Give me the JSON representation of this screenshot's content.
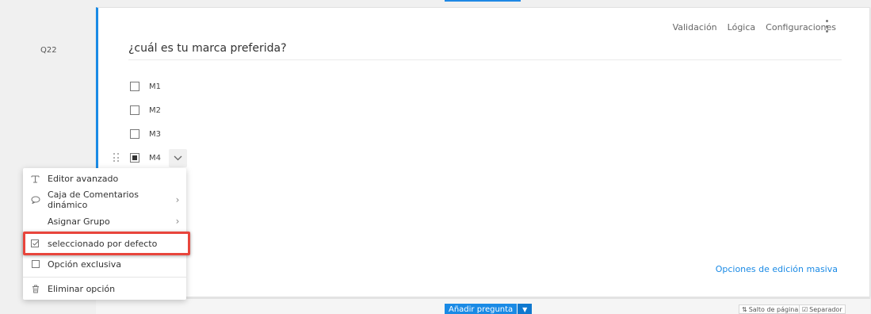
{
  "question": {
    "number": "Q22",
    "title": "¿cuál es tu marca preferida?",
    "actions": [
      "Validación",
      "Lógica",
      "Configuraciones"
    ],
    "options": [
      {
        "label": "M1",
        "checked": false
      },
      {
        "label": "M2",
        "checked": false
      },
      {
        "label": "M3",
        "checked": false
      },
      {
        "label": "M4",
        "checked": true
      }
    ],
    "mass_edit": "Opciones de edición masiva",
    "hidden_fragment": "¿?"
  },
  "context_menu": {
    "items": [
      {
        "icon": "text-format-icon",
        "label": "Editor avanzado",
        "submenu": false
      },
      {
        "icon": "comment-icon",
        "label": "Caja de Comentarios dinámico",
        "submenu": true
      },
      {
        "icon": "",
        "label": "Asignar Grupo",
        "submenu": true
      },
      {
        "icon": "checkbox-checked-icon",
        "label": "seleccionado por defecto",
        "submenu": false,
        "highlighted": true
      },
      {
        "icon": "checkbox-empty-icon",
        "label": "Opción exclusiva",
        "submenu": false
      },
      {
        "icon": "trash-icon",
        "label": "Eliminar opción",
        "submenu": false
      }
    ]
  },
  "bottom_toolbar": {
    "add_question": "Añadir pregunta",
    "page_break": "Salto de página",
    "separator": "Separador"
  },
  "colors": {
    "accent": "#1a8ae5",
    "highlight": "#e8453c"
  }
}
